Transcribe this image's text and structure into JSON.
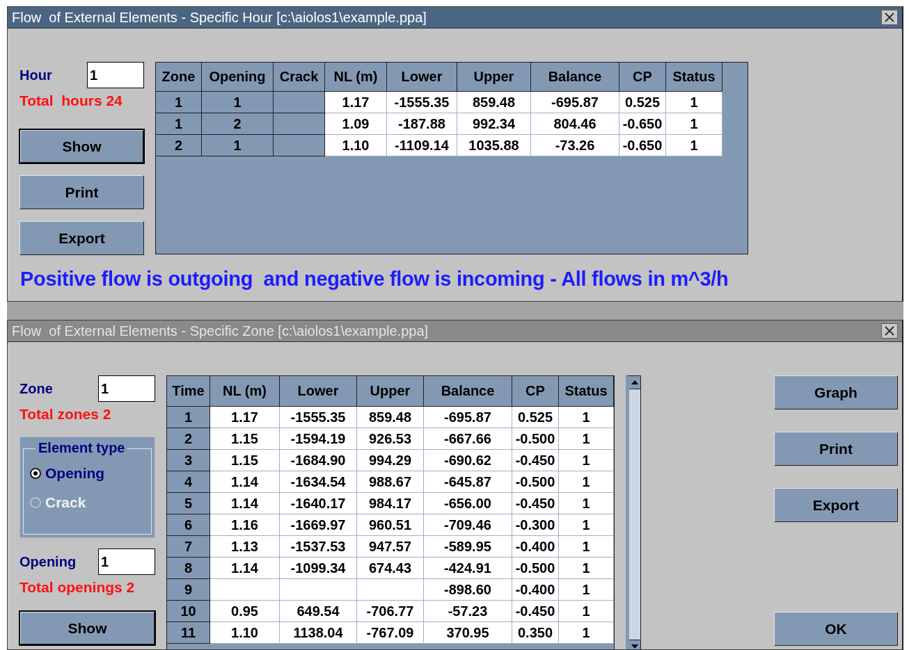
{
  "hour_window": {
    "title": "Flow  of External Elements - Specific Hour [c:\\aiolos1\\example.ppa]",
    "active": true,
    "hour": {
      "label": "Hour",
      "value": "1"
    },
    "total": "Total  hours 24",
    "buttons": [
      {
        "label": "Show",
        "default": true
      },
      {
        "label": "Print",
        "default": false
      },
      {
        "label": "Export",
        "default": false
      }
    ],
    "table": {
      "columns": [
        {
          "label": "Zone",
          "fixed": true
        },
        {
          "label": "Opening",
          "fixed": true
        },
        {
          "label": "Crack",
          "fixed": true
        },
        {
          "label": "NL (m)",
          "fixed": false
        },
        {
          "label": "Lower",
          "fixed": false
        },
        {
          "label": "Upper",
          "fixed": false
        },
        {
          "label": "Balance",
          "fixed": false
        },
        {
          "label": "CP",
          "fixed": false
        },
        {
          "label": "Status",
          "fixed": false
        }
      ],
      "rows": [
        [
          "1",
          "1",
          null,
          "1.17",
          "-1555.35",
          "859.48",
          "-695.87",
          "0.525",
          "1"
        ],
        [
          "1",
          "2",
          null,
          "1.09",
          "-187.88",
          "992.34",
          "804.46",
          "-0.650",
          "1"
        ],
        [
          "2",
          "1",
          null,
          "1.10",
          "-1109.14",
          "1035.88",
          "-73.26",
          "-0.650",
          "1"
        ]
      ]
    },
    "message": "Positive flow is outgoing  and negative flow is incoming - All flows in m^3/h"
  },
  "zone_window": {
    "title": "Flow  of External Elements - Specific Zone [c:\\aiolos1\\example.ppa]",
    "active": false,
    "zone": {
      "label": "Zone",
      "value": "1"
    },
    "total_zones": "Total zones 2",
    "element_type": {
      "legend": "Element type",
      "options": [
        {
          "label": "Opening",
          "selected": true,
          "disabled": false
        },
        {
          "label": "Crack",
          "selected": false,
          "disabled": true
        }
      ]
    },
    "opening": {
      "label": "Opening",
      "value": "1"
    },
    "total_openings": "Total openings 2",
    "left_buttons": [
      {
        "label": "Show",
        "default": true
      }
    ],
    "table": {
      "columns": [
        {
          "label": "Time",
          "fixed": true
        },
        {
          "label": "NL (m)",
          "fixed": false
        },
        {
          "label": "Lower",
          "fixed": false
        },
        {
          "label": "Upper",
          "fixed": false
        },
        {
          "label": "Balance",
          "fixed": false
        },
        {
          "label": "CP",
          "fixed": false
        },
        {
          "label": "Status",
          "fixed": false
        }
      ],
      "rows": [
        [
          "1",
          "1.17",
          "-1555.35",
          "859.48",
          "-695.87",
          "0.525",
          "1"
        ],
        [
          "2",
          "1.15",
          "-1594.19",
          "926.53",
          "-667.66",
          "-0.500",
          "1"
        ],
        [
          "3",
          "1.15",
          "-1684.90",
          "994.29",
          "-690.62",
          "-0.450",
          "1"
        ],
        [
          "4",
          "1.14",
          "-1634.54",
          "988.67",
          "-645.87",
          "-0.500",
          "1"
        ],
        [
          "5",
          "1.14",
          "-1640.17",
          "984.17",
          "-656.00",
          "-0.450",
          "1"
        ],
        [
          "6",
          "1.16",
          "-1669.97",
          "960.51",
          "-709.46",
          "-0.300",
          "1"
        ],
        [
          "7",
          "1.13",
          "-1537.53",
          "947.57",
          "-589.95",
          "-0.400",
          "1"
        ],
        [
          "8",
          "1.14",
          "-1099.34",
          "674.43",
          "-424.91",
          "-0.500",
          "1"
        ],
        [
          "9",
          null,
          null,
          null,
          "-898.60",
          "-0.400",
          "1"
        ],
        [
          "10",
          "0.95",
          "649.54",
          "-706.77",
          "-57.23",
          "-0.450",
          "1"
        ],
        [
          "11",
          "1.10",
          "1138.04",
          "-767.09",
          "370.95",
          "0.350",
          "1"
        ]
      ]
    },
    "right_buttons": [
      {
        "label": "Graph",
        "default": false
      },
      {
        "label": "Print",
        "default": false
      },
      {
        "label": "Export",
        "default": false
      },
      {
        "label": "OK",
        "default": false
      }
    ]
  }
}
